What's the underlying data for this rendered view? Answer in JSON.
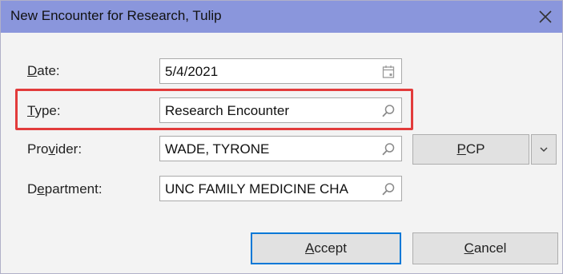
{
  "window": {
    "title": "New Encounter for Research, Tulip",
    "close_icon": "close-icon"
  },
  "fields": {
    "date": {
      "label_prefix": "",
      "label_mnemonic": "D",
      "label_rest": "ate:",
      "value": "5/4/2021",
      "icon": "calendar-icon"
    },
    "type": {
      "label_prefix": "",
      "label_mnemonic": "T",
      "label_rest": "ype:",
      "value": "Research Encounter",
      "icon": "search-icon"
    },
    "provider": {
      "label_prefix": "Pro",
      "label_mnemonic": "v",
      "label_rest": "ider:",
      "value": "WADE, TYRONE",
      "icon": "search-icon"
    },
    "department": {
      "label_prefix": "D",
      "label_mnemonic": "e",
      "label_rest": "partment:",
      "value": "UNC FAMILY MEDICINE CHA",
      "icon": "search-icon"
    }
  },
  "buttons": {
    "pcp": {
      "mnemonic": "P",
      "rest": "CP"
    },
    "accept": {
      "mnemonic": "A",
      "rest": "ccept"
    },
    "cancel": {
      "mnemonic": "C",
      "rest": "ancel"
    }
  },
  "colors": {
    "titlebar": "#8a96dc",
    "highlight_border": "#e23b3b",
    "dialog_bg": "#f3f3f3"
  }
}
